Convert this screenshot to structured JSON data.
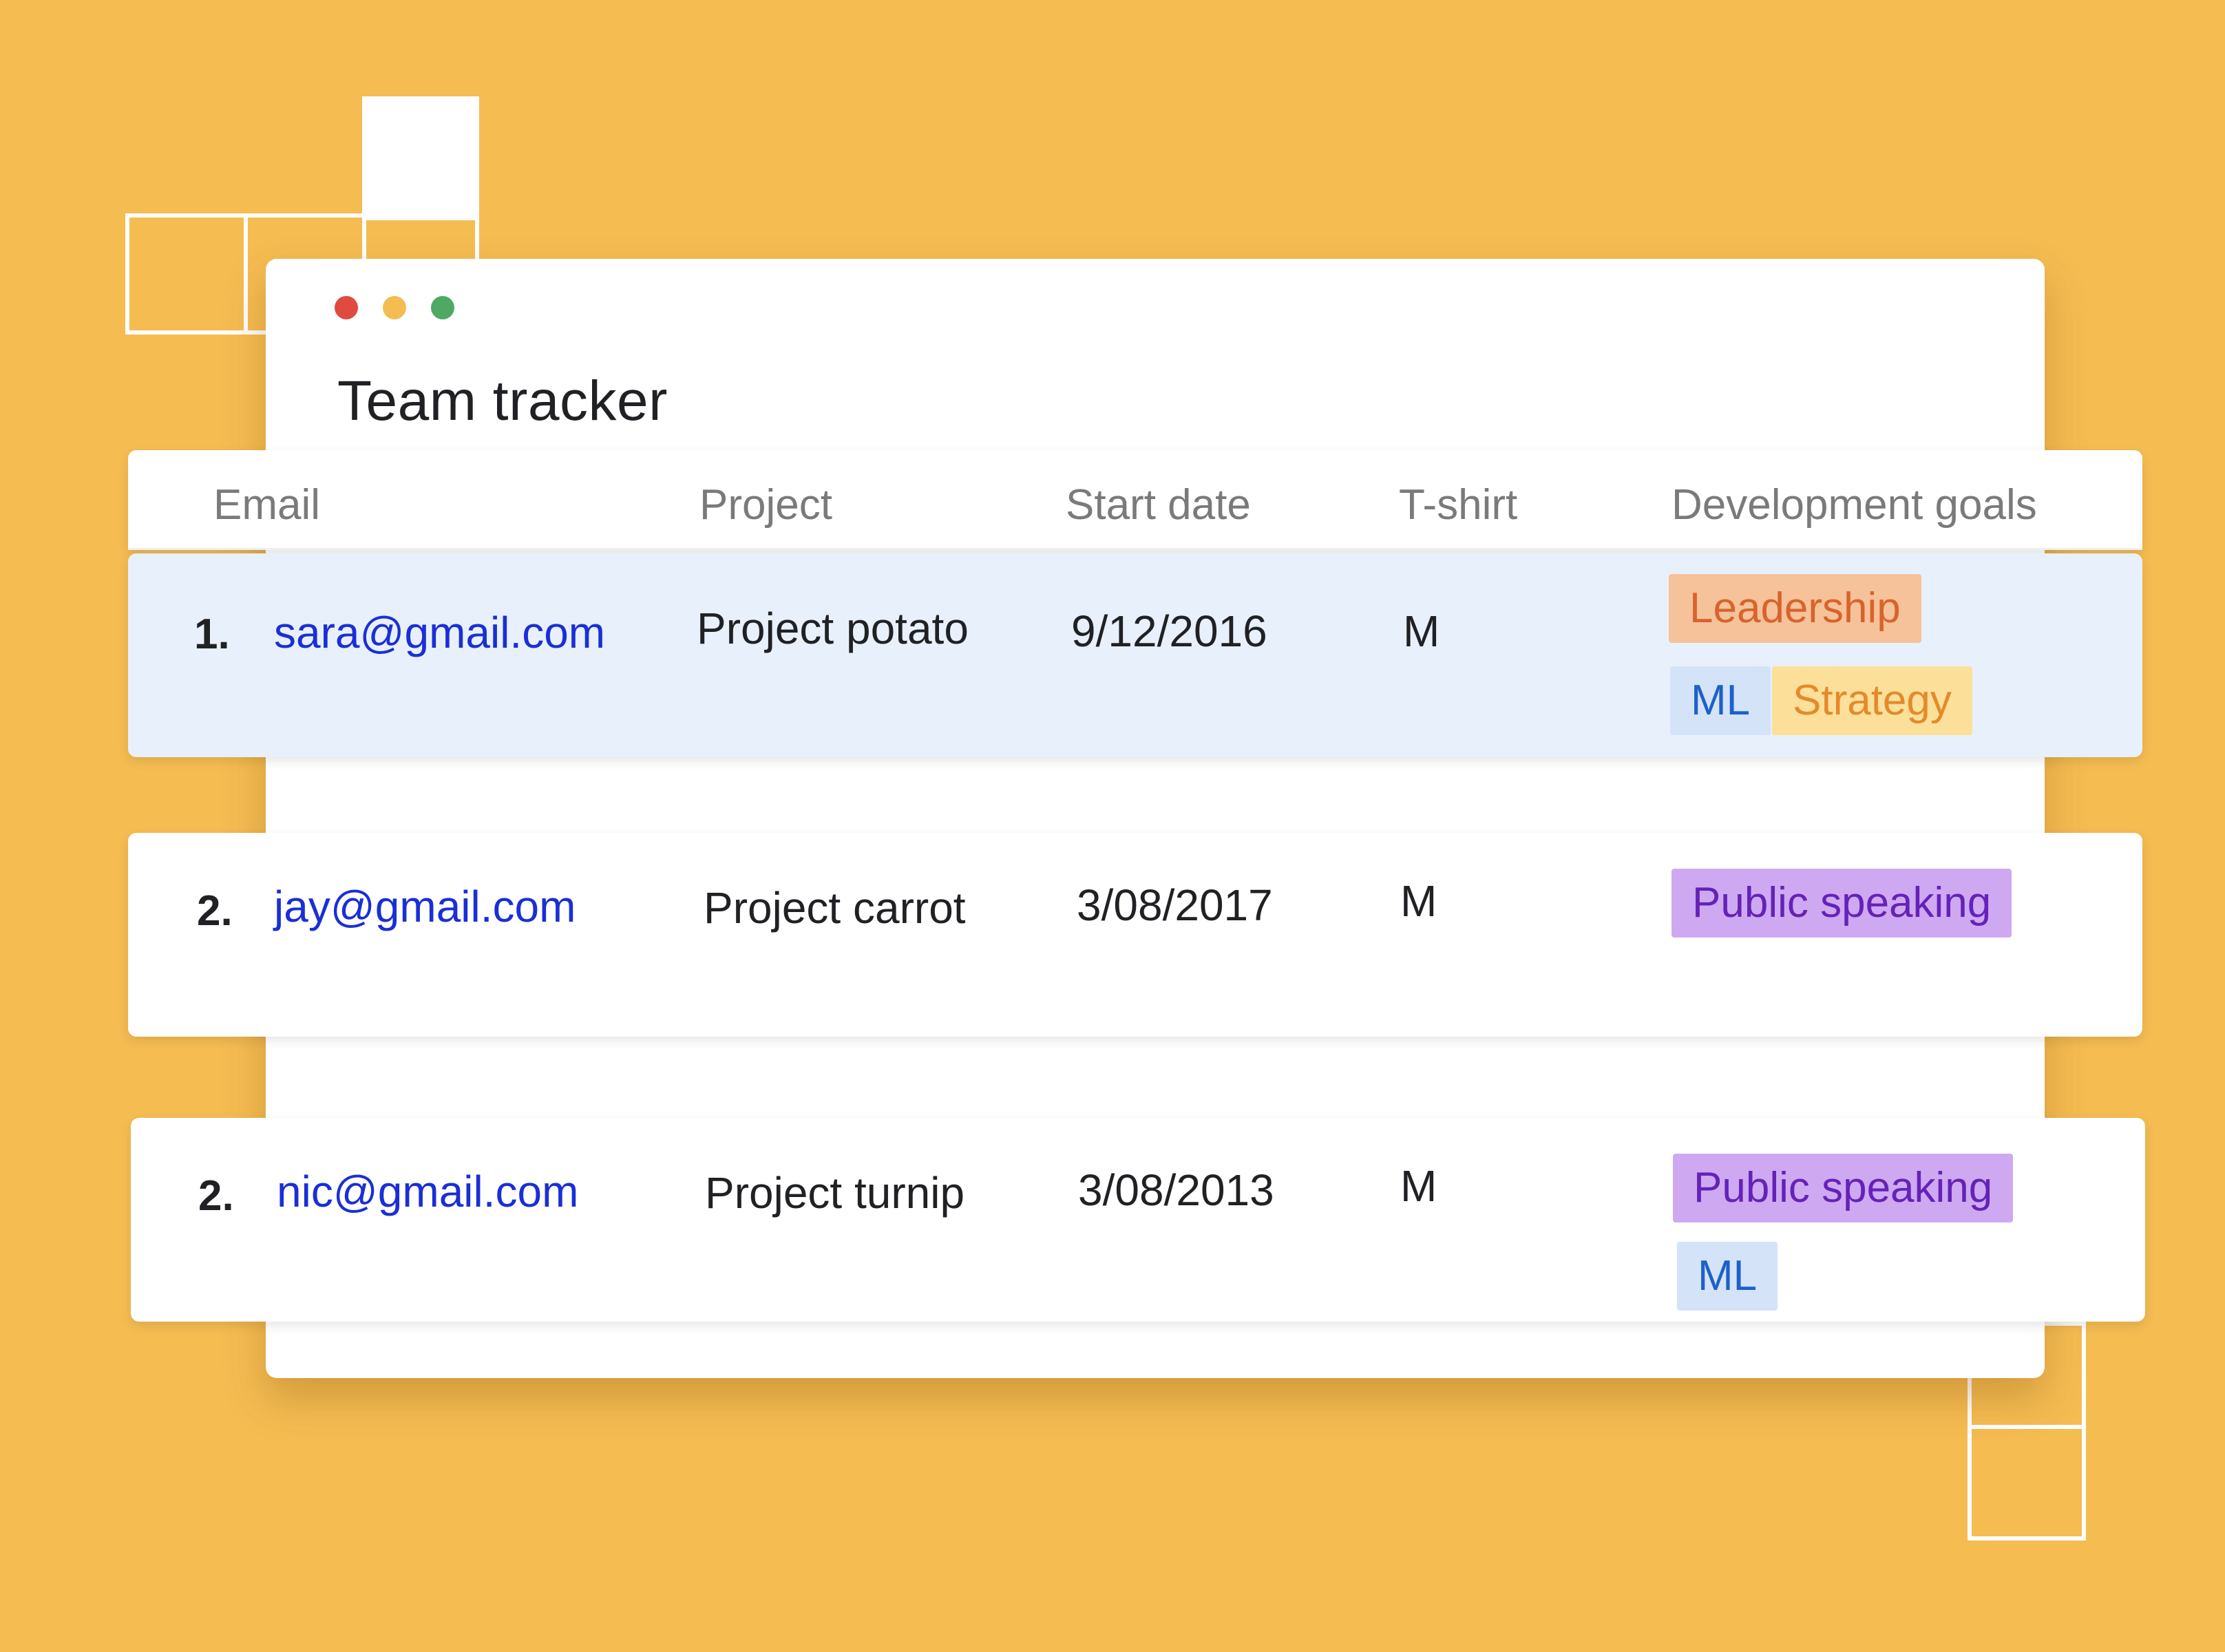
{
  "window": {
    "title": "Team tracker",
    "controls": [
      "close",
      "minimize",
      "maximize"
    ]
  },
  "table": {
    "headers": {
      "email": "Email",
      "project": "Project",
      "start_date": "Start date",
      "tshirt": "T-shirt",
      "goals": "Development goals"
    },
    "rows": [
      {
        "number": "1.",
        "email": "sara@gmail.com",
        "project": "Project potato",
        "start_date": "9/12/2016",
        "tshirt": "M",
        "goals": [
          "Leadership",
          "ML",
          "Strategy"
        ],
        "selected": true
      },
      {
        "number": "2.",
        "email": "jay@gmail.com",
        "project": "Project carrot",
        "start_date": "3/08/2017",
        "tshirt": "M",
        "goals": [
          "Public speaking"
        ]
      },
      {
        "number": "2.",
        "email": "nic@gmail.com",
        "project": "Project turnip",
        "start_date": "3/08/2013",
        "tshirt": "M",
        "goals": [
          "Public speaking",
          "ML"
        ]
      }
    ]
  },
  "colors": {
    "background": "#F5BC52",
    "email_link": "#1A2FD6",
    "selected_row": "#E8F0FB",
    "tag_leadership": "#F6C29A",
    "tag_ml": "#D4E3F8",
    "tag_strategy": "#FCE09A",
    "tag_public_speaking": "#CFA8F2"
  }
}
